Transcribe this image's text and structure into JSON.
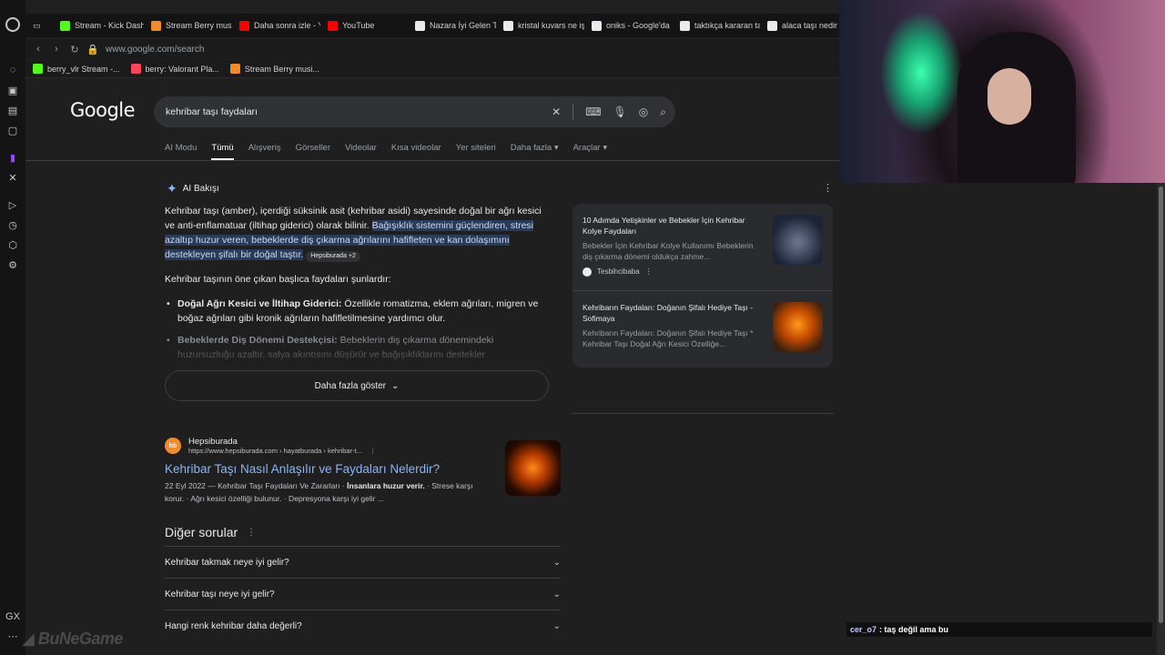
{
  "tabs": [
    {
      "label": "Stream - Kick Dash",
      "color": "#53fc18"
    },
    {
      "label": "Stream Berry mus...",
      "color": "#f28b2c"
    },
    {
      "label": "Daha sonra izle - Y",
      "color": "#ff0000"
    },
    {
      "label": "YouTube",
      "color": "#ff0000"
    },
    {
      "label": "Nazara İyi Gelen T",
      "color": "#e8eaed"
    },
    {
      "label": "kristal kuvars ne iş",
      "color": "#e8eaed"
    },
    {
      "label": "oniks - Google'da",
      "color": "#e8eaed"
    },
    {
      "label": "taktıkça kararan ta",
      "color": "#e8eaed"
    },
    {
      "label": "alaca taşı nedir -",
      "color": "#e8eaed"
    }
  ],
  "address": "www.google.com/search",
  "bookmarks": [
    {
      "label": "berry_vlr Stream -...",
      "color": "#53fc18"
    },
    {
      "label": "berry: Valorant Pla...",
      "color": "#ff4655"
    },
    {
      "label": "Stream Berry musi...",
      "color": "#f28b2c"
    }
  ],
  "logo": "Google",
  "search": {
    "query": "kehribar taşı faydaları"
  },
  "filters": [
    "AI Modu",
    "Tümü",
    "Alışveriş",
    "Görseller",
    "Videolar",
    "Kısa videolar",
    "Yer siteleri",
    "Daha fazla ▾",
    "Araçlar ▾"
  ],
  "ai": {
    "heading": "AI Bakışı",
    "intro_plain": "Kehribar taşı (amber), içerdiği süksinik asit (kehribar asidi) sayesinde doğal bir ağrı kesici ve anti-enflamatuar (iltihap giderici) olarak bilinir.",
    "intro_highlight": "Bağışıklık sistemini güçlendiren, stresi azaltıp huzur veren, bebeklerde diş çıkarma ağrılarını hafifleten ve kan dolaşımını destekleyen şifalı bir doğal taştır.",
    "chip": "Hepsiburada +2",
    "lead": "Kehribar taşının öne çıkan başlıca faydaları şunlardır:",
    "b1_title": "Doğal Ağrı Kesici ve İltihap Giderici:",
    "b1_text": "Özellikle romatizma, eklem ağrıları, migren ve boğaz ağrıları gibi kronik ağrıların hafifletilmesine yardımcı olur.",
    "b2_title": "Bebeklerde Diş Dönemi Destekçisi:",
    "b2_text": "Bebeklerin diş çıkarma dönemindeki huzursuzluğu azaltır, salya akıntısını düşürür ve bağışıklıklarını destekler.",
    "more": "Daha fazla göster"
  },
  "sources": [
    {
      "title": "10 Adımda Yetişkinler ve Bebekler İçin Kehribar Kolye Faydaları",
      "snippet": "Bebekler İçin Kehribar Kolye Kullanımı Bebeklerin diş çıkarma dönemi oldukça zahme...",
      "site": "Tesbihcibaba"
    },
    {
      "title": "Kehribarın Faydaları: Doğanın Şifalı Hediye Taşı - Sofimaya",
      "snippet": "Kehribarın Faydaları: Doğanın Şifalı Hediye Taşı * Kehribar Taşı Doğal Ağrı Kesici Özelliğe..."
    }
  ],
  "result": {
    "fav": "hb",
    "site": "Hepsiburada",
    "url": "https://www.hepsiburada.com › hayatburada › kehribar-t...",
    "title": "Kehribar Taşı Nasıl Anlaşılır ve Faydaları Nelerdir?",
    "snippet_a": "22 Eyl 2022 — Kehribar Taşı Faydaları Ve Zararları ·",
    "snippet_b": "İnsanlara huzur verir.",
    "snippet_c": "· Strese karşı korur. · Ağrı kesici özelliği bulunur. · Depresyona karşı iyi gelir ..."
  },
  "paa": {
    "title": "Diğer sorular",
    "items": [
      "Kehribar takmak neye iyi gelir?",
      "Kehribar taşı neye iyi gelir?",
      "Hangi renk kehribar daha değerli?"
    ]
  },
  "chat": {
    "user": "cer_o7",
    "message": ": taş değil ama bu"
  },
  "watermark": "BuNeGame"
}
